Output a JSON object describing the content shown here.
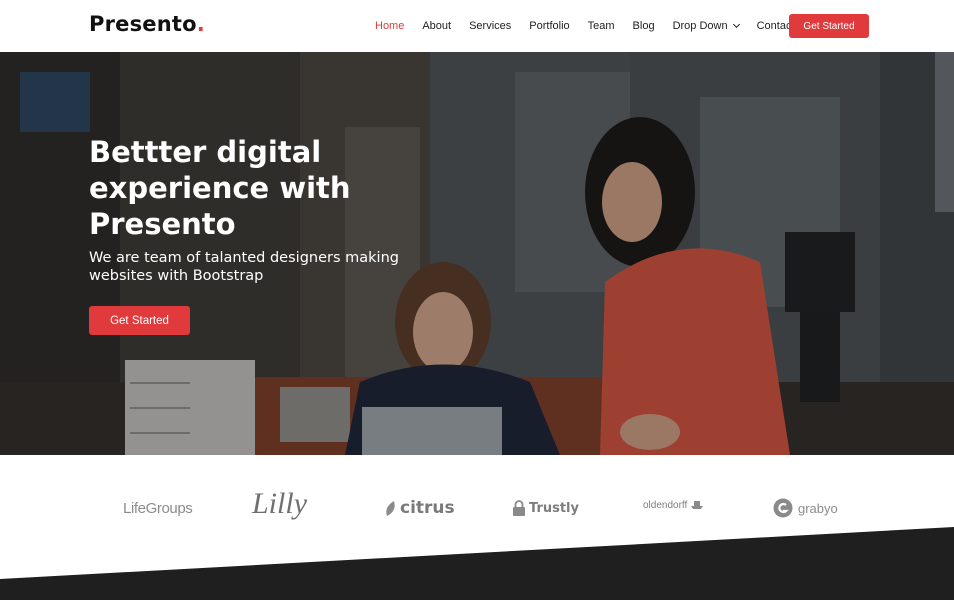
{
  "header": {
    "logo_text": "Presento",
    "logo_dot": ".",
    "nav": [
      {
        "label": "Home",
        "active": true
      },
      {
        "label": "About"
      },
      {
        "label": "Services"
      },
      {
        "label": "Portfolio"
      },
      {
        "label": "Team"
      },
      {
        "label": "Blog"
      },
      {
        "label": "Drop Down",
        "icon": "chevron-down-icon"
      },
      {
        "label": "Contact"
      }
    ],
    "cta_label": "Get Started"
  },
  "hero": {
    "title": "Bettter digital experience with Presento",
    "subtitle": "We are team of talanted designers making websites with Bootstrap",
    "cta_label": "Get Started"
  },
  "clients": {
    "logos": [
      "LifeGroups",
      "Lilly",
      "citrus",
      "Trustly",
      "oldendorff",
      "grabyo"
    ]
  },
  "colors": {
    "accent": "#e03a3c",
    "footer_dark": "#1f1f20"
  }
}
